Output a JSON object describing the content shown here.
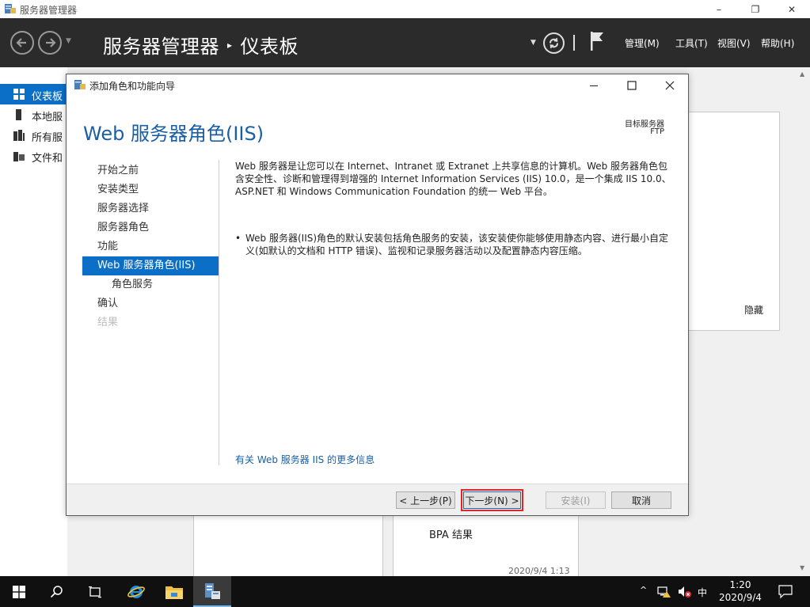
{
  "window": {
    "title": "服务器管理器",
    "minimize": "–",
    "restore": "❐",
    "close": "✕"
  },
  "header": {
    "breadcrumb_root": "服务器管理器",
    "breadcrumb_sep": "▸",
    "breadcrumb_page": "仪表板",
    "menus": [
      "管理(M)",
      "工具(T)",
      "视图(V)",
      "帮助(H)"
    ]
  },
  "sidebar": {
    "items": [
      {
        "label": "仪表板",
        "icon": "dashboard-icon",
        "active": true
      },
      {
        "label": "本地服",
        "icon": "local-server-icon",
        "active": false
      },
      {
        "label": "所有服",
        "icon": "all-servers-icon",
        "active": false
      },
      {
        "label": "文件和",
        "icon": "file-services-icon",
        "active": false
      }
    ]
  },
  "background": {
    "hide_label": "隐藏",
    "bpa_label": "BPA 结果",
    "timestamp": "2020/9/4 1:13"
  },
  "dialog": {
    "title": "添加角色和功能向导",
    "heading": "Web 服务器角色(IIS)",
    "target_label": "目标服务器",
    "target_value": "FTP",
    "steps": [
      {
        "label": "开始之前",
        "state": "normal"
      },
      {
        "label": "安装类型",
        "state": "normal"
      },
      {
        "label": "服务器选择",
        "state": "normal"
      },
      {
        "label": "服务器角色",
        "state": "normal"
      },
      {
        "label": "功能",
        "state": "normal"
      },
      {
        "label": "Web 服务器角色(IIS)",
        "state": "current"
      },
      {
        "label": "角色服务",
        "state": "sub"
      },
      {
        "label": "确认",
        "state": "normal"
      },
      {
        "label": "结果",
        "state": "disabled"
      }
    ],
    "description": "Web 服务器是让您可以在 Internet、Intranet 或 Extranet 上共享信息的计算机。Web 服务器角色包含安全性、诊断和管理得到增强的 Internet Information Services (IIS) 10.0，是一个集成 IIS 10.0、ASP.NET 和 Windows Communication Foundation 的统一 Web 平台。",
    "bullet": "Web 服务器(IIS)角色的默认安装包括角色服务的安装，该安装使你能够使用静态内容、进行最小自定义(如默认的文档和 HTTP 错误)、监视和记录服务器活动以及配置静态内容压缩。",
    "more_link": "有关 Web 服务器 IIS 的更多信息",
    "buttons": {
      "prev": "< 上一步(P)",
      "next": "下一步(N) >",
      "install": "安装(I)",
      "cancel": "取消"
    }
  },
  "taskbar": {
    "ime": "中",
    "time": "1:20",
    "date": "2020/9/4"
  }
}
